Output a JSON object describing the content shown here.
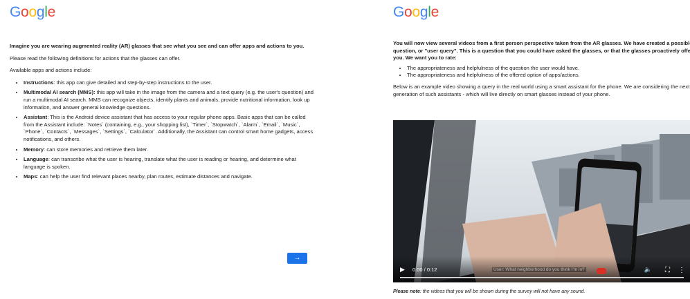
{
  "left": {
    "logo": "Google",
    "heading": "Imagine you are wearing augmented reality (AR) glasses that see what you see and can offer apps and actions to you.",
    "intro": "Please read the following definitions for actions that the glasses can offer.",
    "available_label": "Available apps and actions include:",
    "items": [
      {
        "term": "Instructions",
        "desc": ": this app can give detailed and step-by-step instructions to the user."
      },
      {
        "term": "Multimodal AI search (MMS):",
        "desc": " this app will take in the image from the camera and a text query (e.g. the user's question) and run a multimodal AI search. MMS can recognize objects, identify plants and animals, provide nutritional information, look up information, and answer general knowledge questions."
      },
      {
        "term": "Assistant",
        "desc": ": This is the Android device assistant that has access to your regular phone apps. Basic apps that can be called from the Assistant include: `Notes` (containing, e.g., your shopping list), `Timer`, `Stopwatch`, `Alarm`, `Email`, `Music`, `Phone`, `Contacts`, `Messages`, `Settings`, `Calculator`. Additionally, the Assistant can control smart home gadgets, access notifications, and others."
      },
      {
        "term": "Memory",
        "desc": ": can store memories and retrieve them later."
      },
      {
        "term": "Language",
        "desc": ": can transcribe what the user is hearing, translate what the user is reading or hearing, and determine what language is spoken."
      },
      {
        "term": "Maps",
        "desc": ": can help the user find relevant places nearby, plan routes, estimate distances and navigate."
      }
    ],
    "next_button": "→"
  },
  "right": {
    "logo": "Google",
    "heading": "You will now view several videos from a first person perspective taken from the AR glasses. We have created a possible question, or \"user query\". This is a question that you could have asked the glasses, or that the glasses proactively offer to you. We want you to rate:",
    "rate_items": [
      "The appropriateness and helpfulness of the question the user would have.",
      "The appropriateness and helpfulness of the offered option of apps/actions."
    ],
    "example_text": "Below is an example video showing a query in the real world using a smart assistant for the phone. We are considering the next generation of such assistants - which will live directly on smart glasses instead of your phone.",
    "video": {
      "time": "0:00 / 0:12",
      "caption": "User: What neighborhood do you think I'm in?",
      "progress": 0
    },
    "note_bold": "Please note",
    "note_rest": ": the videos that you will be shown during the survey will not have any sound."
  },
  "colors": {
    "primary": "#1a73e8",
    "text": "#202124"
  }
}
